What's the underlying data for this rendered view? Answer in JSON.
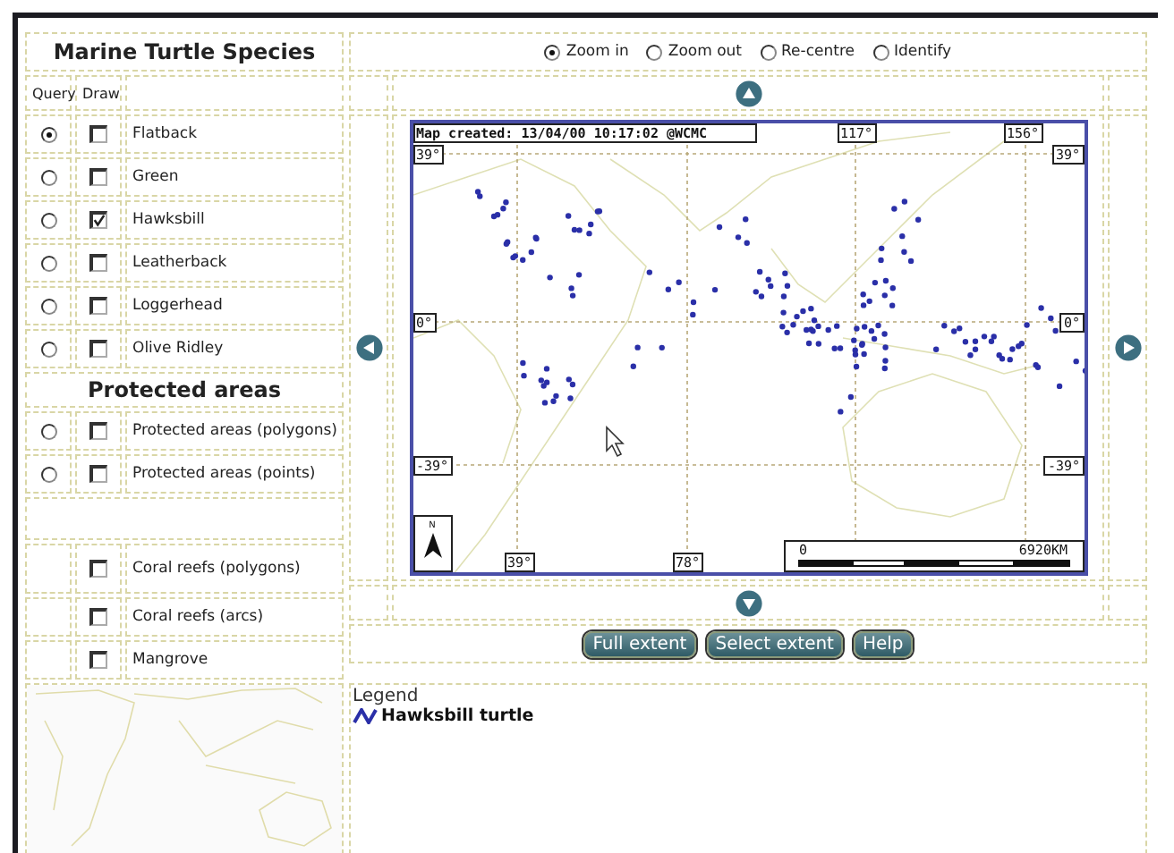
{
  "species_panel": {
    "title": "Marine Turtle Species",
    "column_headers": [
      "Query",
      "Draw"
    ],
    "species": [
      {
        "label": "Flatback",
        "query_selected": true,
        "draw_checked": false
      },
      {
        "label": "Green",
        "query_selected": false,
        "draw_checked": false
      },
      {
        "label": "Hawksbill",
        "query_selected": false,
        "draw_checked": true
      },
      {
        "label": "Leatherback",
        "query_selected": false,
        "draw_checked": false
      },
      {
        "label": "Loggerhead",
        "query_selected": false,
        "draw_checked": false
      },
      {
        "label": "Olive Ridley",
        "query_selected": false,
        "draw_checked": false
      }
    ]
  },
  "protected_areas": {
    "title": "Protected areas",
    "layers": [
      {
        "label": "Protected areas (polygons)",
        "query_selected": false,
        "draw_checked": false
      },
      {
        "label": "Protected areas (points)",
        "query_selected": false,
        "draw_checked": false
      }
    ]
  },
  "habitats": [
    {
      "label": "Coral reefs (polygons)",
      "draw_checked": false
    },
    {
      "label": "Coral reefs (arcs)",
      "draw_checked": false
    },
    {
      "label": "Mangrove",
      "draw_checked": false
    }
  ],
  "tools": [
    {
      "label": "Zoom in",
      "selected": true
    },
    {
      "label": "Zoom out",
      "selected": false
    },
    {
      "label": "Re-centre",
      "selected": false
    },
    {
      "label": "Identify",
      "selected": false
    }
  ],
  "map": {
    "created": "Map created: 13/04/00 10:17:02 @WCMC",
    "top_labels": [
      "117°",
      "156°"
    ],
    "left_labels": [
      "39°",
      "0°",
      "-39°"
    ],
    "right_labels": [
      "39°",
      "0°",
      "-39°"
    ],
    "bottom_labels": [
      "39°",
      "78°"
    ],
    "north_label": "N",
    "scale": {
      "start": "0",
      "end": "6920KM"
    }
  },
  "buttons": [
    "Full extent",
    "Select extent",
    "Help"
  ],
  "legend": {
    "title": "Legend",
    "items": [
      {
        "label": "Hawksbill turtle"
      }
    ]
  }
}
